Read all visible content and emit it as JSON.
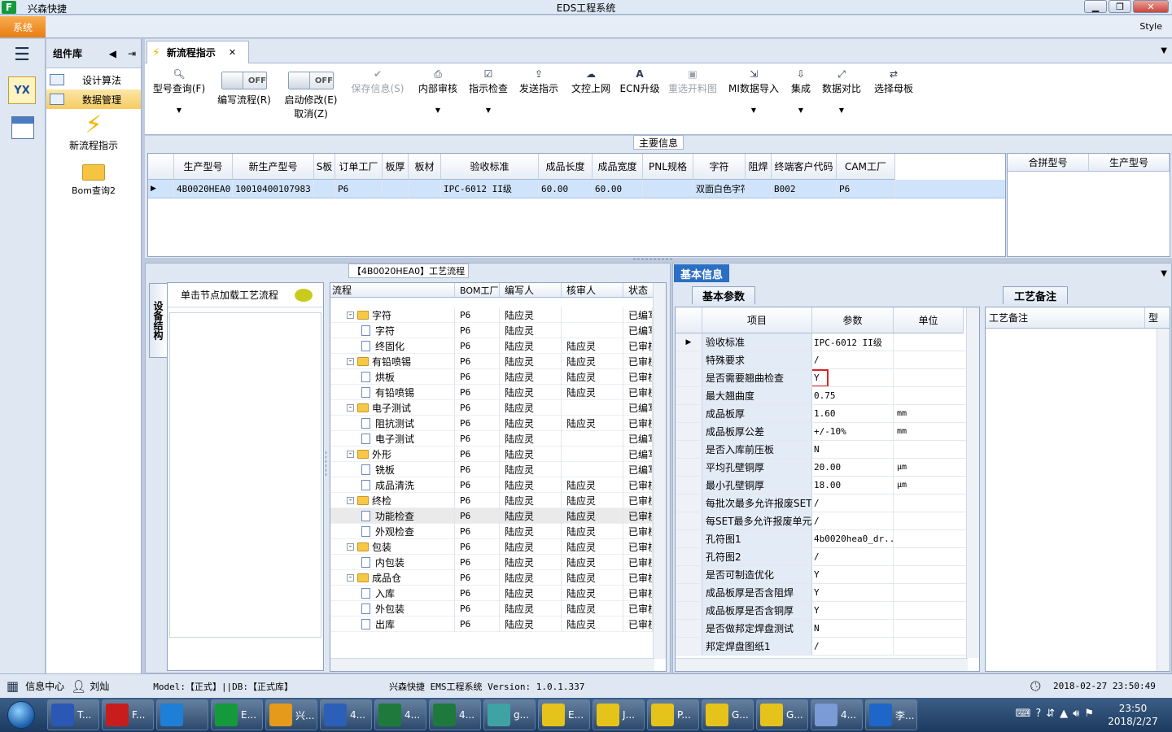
{
  "window": {
    "app_name": "兴森快捷",
    "title": "EDS工程系统",
    "style_label": "Style"
  },
  "menu": {
    "system": "系统"
  },
  "sidebar": {
    "header": "组件库",
    "items": [
      {
        "label": "设计算法"
      },
      {
        "label": "数据管理"
      }
    ],
    "tiles": [
      {
        "label": "新流程指示"
      },
      {
        "label": "Bom查询2"
      }
    ]
  },
  "tab": {
    "label": "新流程指示"
  },
  "ribbon": {
    "buttons": [
      {
        "label": "型号查询(F)",
        "icon": "search-icon"
      },
      {
        "label": "编写流程(R)",
        "toggle": "OFF"
      },
      {
        "label": "启动修改(E)",
        "label2": "取消(Z)",
        "toggle": "OFF"
      },
      {
        "label": "保存信息(S)",
        "icon": "check-icon"
      },
      {
        "label": "内部审核",
        "icon": "printer-icon"
      },
      {
        "label": "指示检查",
        "icon": "checkbox-icon"
      },
      {
        "label": "发送指示",
        "icon": "upload-icon"
      },
      {
        "label": "文控上网",
        "icon": "cloud-upload-icon"
      },
      {
        "label": "ECN升级",
        "icon": "font-icon"
      },
      {
        "label": "重选开料图",
        "icon": "image-icon"
      },
      {
        "label": "MI数据导入",
        "icon": "import-icon"
      },
      {
        "label": "集成",
        "icon": "download-icon"
      },
      {
        "label": "数据对比",
        "icon": "compare-icon"
      },
      {
        "label": "选择母板",
        "icon": "shuffle-icon"
      }
    ]
  },
  "main_info": {
    "title": "主要信息",
    "columns": [
      "生产型号",
      "新生产型号",
      "S板",
      "订单工厂",
      "板厚",
      "板材",
      "验收标准",
      "成品长度",
      "成品宽度",
      "PNL规格",
      "字符",
      "阻焊",
      "终端客户代码",
      "CAM工厂"
    ],
    "row": [
      "4B0020HEA0",
      "10010400107983",
      "",
      "P6",
      "",
      "",
      "IPC-6012 II级",
      "60.00",
      "60.00",
      "",
      "双面白色字符",
      "",
      "B002",
      "P6"
    ],
    "side_columns": [
      "合拼型号",
      "生产型号"
    ]
  },
  "process": {
    "title": "【4B0020HEA0】工艺流程",
    "vertical_tab": "设备结构",
    "hint": "单击节点加载工艺流程",
    "columns": [
      "流程",
      "BOM工厂",
      "编写人",
      "核审人",
      "状态"
    ],
    "rows": [
      {
        "name": "字符",
        "level": 0,
        "folder": true,
        "factory": "P6",
        "writer": "陆应灵",
        "reviewer": "",
        "status": "已编写"
      },
      {
        "name": "字符",
        "level": 1,
        "factory": "P6",
        "writer": "陆应灵",
        "reviewer": "",
        "status": "已编写"
      },
      {
        "name": "终固化",
        "level": 1,
        "factory": "P6",
        "writer": "陆应灵",
        "reviewer": "陆应灵",
        "status": "已审核"
      },
      {
        "name": "有铅喷锡",
        "level": 0,
        "folder": true,
        "factory": "P6",
        "writer": "陆应灵",
        "reviewer": "陆应灵",
        "status": "已审核"
      },
      {
        "name": "烘板",
        "level": 1,
        "factory": "P6",
        "writer": "陆应灵",
        "reviewer": "陆应灵",
        "status": "已审核"
      },
      {
        "name": "有铅喷锡",
        "level": 1,
        "factory": "P6",
        "writer": "陆应灵",
        "reviewer": "陆应灵",
        "status": "已审核"
      },
      {
        "name": "电子测试",
        "level": 0,
        "folder": true,
        "factory": "P6",
        "writer": "陆应灵",
        "reviewer": "",
        "status": "已编写"
      },
      {
        "name": "阻抗测试",
        "level": 1,
        "factory": "P6",
        "writer": "陆应灵",
        "reviewer": "陆应灵",
        "status": "已审核"
      },
      {
        "name": "电子测试",
        "level": 1,
        "factory": "P6",
        "writer": "陆应灵",
        "reviewer": "",
        "status": "已编写"
      },
      {
        "name": "外形",
        "level": 0,
        "folder": true,
        "factory": "P6",
        "writer": "陆应灵",
        "reviewer": "",
        "status": "已编写"
      },
      {
        "name": "铣板",
        "level": 1,
        "factory": "P6",
        "writer": "陆应灵",
        "reviewer": "",
        "status": "已编写"
      },
      {
        "name": "成品清洗",
        "level": 1,
        "factory": "P6",
        "writer": "陆应灵",
        "reviewer": "陆应灵",
        "status": "已审核"
      },
      {
        "name": "终检",
        "level": 0,
        "folder": true,
        "factory": "P6",
        "writer": "陆应灵",
        "reviewer": "陆应灵",
        "status": "已审核"
      },
      {
        "name": "功能检查",
        "level": 1,
        "factory": "P6",
        "writer": "陆应灵",
        "reviewer": "陆应灵",
        "status": "已审核",
        "highlight": true
      },
      {
        "name": "外观检查",
        "level": 1,
        "factory": "P6",
        "writer": "陆应灵",
        "reviewer": "陆应灵",
        "status": "已审核"
      },
      {
        "name": "包装",
        "level": 0,
        "folder": true,
        "factory": "P6",
        "writer": "陆应灵",
        "reviewer": "陆应灵",
        "status": "已审核"
      },
      {
        "name": "内包装",
        "level": 1,
        "factory": "P6",
        "writer": "陆应灵",
        "reviewer": "陆应灵",
        "status": "已审核"
      },
      {
        "name": "成品仓",
        "level": 0,
        "folder": true,
        "factory": "P6",
        "writer": "陆应灵",
        "reviewer": "陆应灵",
        "status": "已审核"
      },
      {
        "name": "入库",
        "level": 1,
        "factory": "P6",
        "writer": "陆应灵",
        "reviewer": "陆应灵",
        "status": "已审核"
      },
      {
        "name": "外包装",
        "level": 1,
        "factory": "P6",
        "writer": "陆应灵",
        "reviewer": "陆应灵",
        "status": "已审核"
      },
      {
        "name": "出库",
        "level": 1,
        "factory": "P6",
        "writer": "陆应灵",
        "reviewer": "陆应灵",
        "status": "已审核"
      }
    ]
  },
  "basic_info": {
    "title": "基本信息",
    "tab": "基本参数",
    "columns": [
      "项目",
      "参数",
      "单位"
    ],
    "rows": [
      {
        "k": "验收标准",
        "v": "IPC-6012 II级",
        "u": ""
      },
      {
        "k": "特殊要求",
        "v": "/",
        "u": ""
      },
      {
        "k": "是否需要翘曲检查",
        "v": "Y",
        "u": "",
        "marked": true
      },
      {
        "k": "最大翘曲度",
        "v": "0.75",
        "u": ""
      },
      {
        "k": "成品板厚",
        "v": "1.60",
        "u": "mm"
      },
      {
        "k": "成品板厚公差",
        "v": "+/-10%",
        "u": "mm"
      },
      {
        "k": "是否入库前压板",
        "v": "N",
        "u": ""
      },
      {
        "k": "平均孔壁铜厚",
        "v": "20.00",
        "u": "μm"
      },
      {
        "k": "最小孔壁铜厚",
        "v": "18.00",
        "u": "μm"
      },
      {
        "k": "每批次最多允许报废SET",
        "v": "/",
        "u": ""
      },
      {
        "k": "每SET最多允许报废单元",
        "v": "/",
        "u": ""
      },
      {
        "k": "孔符图1",
        "v": "4b0020hea0_dr...",
        "u": ""
      },
      {
        "k": "孔符图2",
        "v": "/",
        "u": ""
      },
      {
        "k": "是否可制造优化",
        "v": "Y",
        "u": ""
      },
      {
        "k": "成品板厚是否含阻焊",
        "v": "Y",
        "u": ""
      },
      {
        "k": "成品板厚是否含铜厚",
        "v": "Y",
        "u": ""
      },
      {
        "k": "是否做邦定焊盘测试",
        "v": "N",
        "u": ""
      },
      {
        "k": "邦定焊盘图纸1",
        "v": "/",
        "u": ""
      }
    ]
  },
  "remarks": {
    "tab": "工艺备注",
    "columns": [
      "工艺备注",
      "型"
    ]
  },
  "status": {
    "info_center": "信息中心",
    "user": "刘灿",
    "model": "Model:【正式】||DB:【正式库】",
    "product": "兴森快捷 EMS工程系统 Version: 1.0.1.337",
    "datetime": "2018-02-27 23:50:49"
  },
  "taskbar": {
    "items": [
      {
        "label": "T...",
        "color": "#2b58b5"
      },
      {
        "label": "F...",
        "color": "#c81d1d"
      },
      {
        "label": "",
        "color": "#1d7fd6"
      },
      {
        "label": "E...",
        "color": "#159a3b"
      },
      {
        "label": "兴...",
        "color": "#e69a1b"
      },
      {
        "label": "4...",
        "color": "#2b5fb8"
      },
      {
        "label": "4...",
        "color": "#1e7a3c"
      },
      {
        "label": "4...",
        "color": "#1e7a3c"
      },
      {
        "label": "g...",
        "color": "#3fa3a3"
      },
      {
        "label": "E...",
        "color": "#e5c31b"
      },
      {
        "label": "J...",
        "color": "#e5c31b"
      },
      {
        "label": "P...",
        "color": "#e5c31b"
      },
      {
        "label": "G...",
        "color": "#e5c31b"
      },
      {
        "label": "G...",
        "color": "#e5c31b"
      },
      {
        "label": "4...",
        "color": "#7a9bd6"
      },
      {
        "label": "李...",
        "color": "#1e66c8"
      }
    ],
    "time": "23:50",
    "date": "2018/2/27"
  }
}
